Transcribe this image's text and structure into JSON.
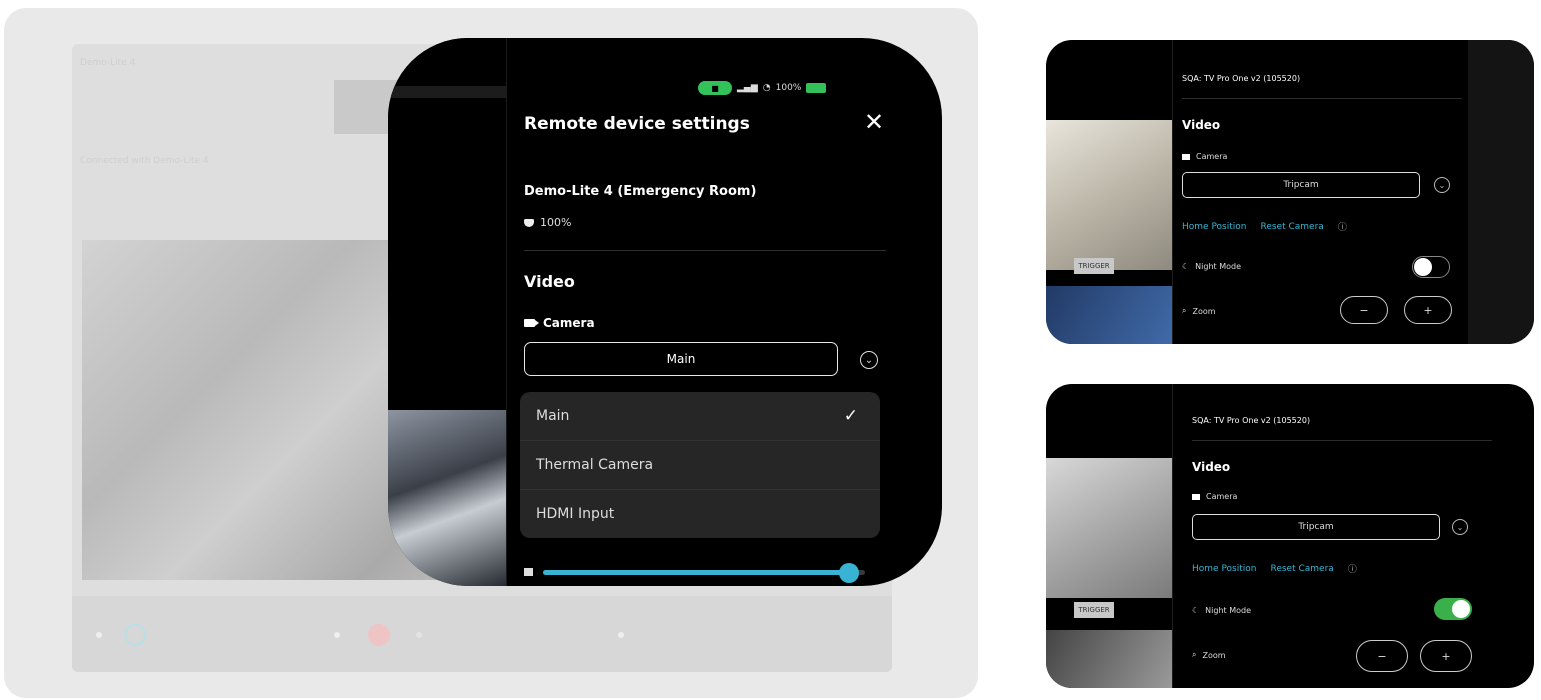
{
  "tablet": {
    "title": "Demo-Lite 4",
    "subtitle": "Connected with Demo-Lite 4"
  },
  "zoom_panel": {
    "status": {
      "pill": "■",
      "battery_text": "100%"
    },
    "title": "Remote device settings",
    "close_icon": "close-icon",
    "device_name": "Demo-Lite 4 (Emergency Room)",
    "battery": "100%",
    "section": "Video",
    "camera_label": "Camera",
    "camera_value": "Main",
    "chevron": "⌄",
    "dropdown_options": [
      {
        "label": "Main",
        "selected": true
      },
      {
        "label": "Thermal Camera",
        "selected": false
      },
      {
        "label": "HDMI Input",
        "selected": false
      }
    ],
    "check": "✓",
    "volume_level": 0.95,
    "accent_color": "#39b3d4"
  },
  "phone_top": {
    "device_name": "SQA: TV Pro One v2 (105520)",
    "section": "Video",
    "camera_label": "Camera",
    "camera_value": "Tripcam",
    "home_position": "Home Position",
    "reset_camera": "Reset Camera",
    "info": "ⓘ",
    "night_mode_label": "Night Mode",
    "night_mode_on": false,
    "zoom_label": "Zoom",
    "zoom_out": "−",
    "zoom_in": "+",
    "tag": "TRIGGER"
  },
  "phone_bottom": {
    "device_name": "SQA: TV Pro One v2 (105520)",
    "section": "Video",
    "camera_label": "Camera",
    "camera_value": "Tripcam",
    "home_position": "Home Position",
    "reset_camera": "Reset Camera",
    "info": "ⓘ",
    "night_mode_label": "Night Mode",
    "night_mode_on": true,
    "zoom_label": "Zoom",
    "zoom_out": "−",
    "zoom_in": "+",
    "tag": "TRIGGER",
    "toggle_color": "#3ab04a"
  }
}
